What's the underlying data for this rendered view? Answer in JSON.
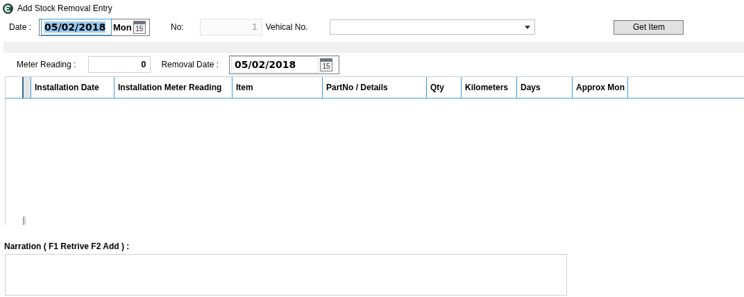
{
  "window": {
    "title": "Add Stock Removal Entry"
  },
  "header": {
    "date": {
      "label": "Date :",
      "value": "05/02/2018",
      "focused": true,
      "weekday": "Mon",
      "calendar_day": "15"
    },
    "number": {
      "label": "No:",
      "value": "1",
      "disabled": true
    },
    "vehicle": {
      "label": "Vehical No."
    },
    "get_item_button": "Get Item"
  },
  "removal": {
    "meter_reading": {
      "label": "Meter Reading :",
      "value": "0"
    },
    "removal_date": {
      "label": "Removal Date :",
      "value": "05/02/2018",
      "focused": false,
      "calendar_day": "15"
    }
  },
  "table": {
    "columns": [
      "Installation Date",
      "Installation Meter Reading",
      "Item",
      "PartNo / Details",
      "Qty",
      "Kilometers",
      "Days",
      "Approx Mon"
    ]
  },
  "narration": {
    "label": "Narration ( F1 Retrive F2 Add ) :"
  }
}
